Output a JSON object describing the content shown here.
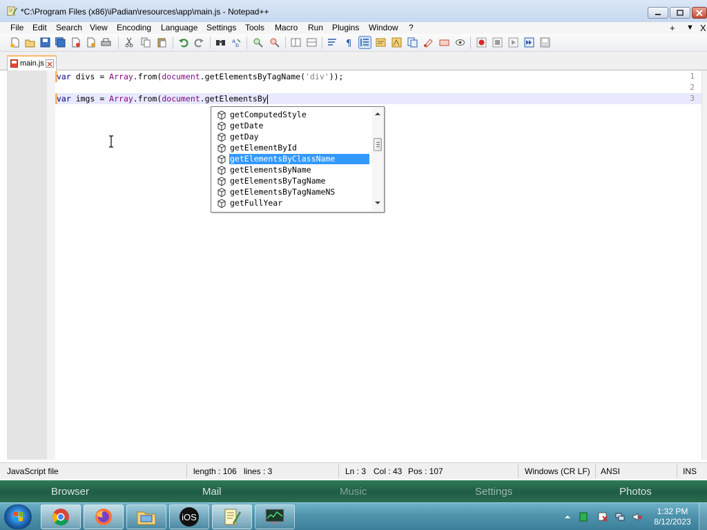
{
  "window": {
    "title": "*C:\\Program Files (x86)\\iPadian\\resources\\app\\main.js - Notepad++",
    "app_icon": "notepad-plus-plus-icon",
    "controls": [
      "minimize-icon",
      "maximize-icon",
      "close-icon"
    ]
  },
  "menu": {
    "items": [
      "File",
      "Edit",
      "Search",
      "View",
      "Encoding",
      "Language",
      "Settings",
      "Tools",
      "Macro",
      "Run",
      "Plugins",
      "Window",
      "?"
    ],
    "right": [
      "+",
      "▼",
      "X"
    ]
  },
  "toolbar": {
    "icons": [
      "new-file-icon",
      "open-file-icon",
      "save-icon",
      "save-all-icon",
      "close-icon",
      "close-all-icon",
      "print-icon",
      "cut-icon",
      "copy-icon",
      "paste-icon",
      "undo-icon",
      "redo-icon",
      "find-icon",
      "replace-icon",
      "zoom-in-icon",
      "zoom-out-icon",
      "sync-vertical-icon",
      "sync-horizontal-icon",
      "word-wrap-icon",
      "show-all-characters-icon",
      "indent-guide-icon",
      "language-icon",
      "document-map-icon",
      "function-list-icon",
      "folder-workspace-icon",
      "monitoring-icon",
      "record-macro-icon",
      "stop-macro-icon",
      "play-macro-icon",
      "run-macro-multiple-icon",
      "save-macro-icon"
    ]
  },
  "tab": {
    "label": "main.js",
    "icon": "modified-file-icon"
  },
  "editor": {
    "line_numbers": [
      "1",
      "2",
      "3"
    ],
    "lines": [
      {
        "kw": "var",
        "ident": " divs = ",
        "obj": "Array",
        "mid": ".from(",
        "obj2": "document",
        "rest": ".getElementsByTagName(",
        "str": "'div'",
        "end": "));"
      },
      {},
      {
        "kw": "var",
        "ident": " imgs = ",
        "obj": "Array",
        "mid": ".from(",
        "obj2": "document",
        "rest": ".getElementsBy"
      }
    ]
  },
  "autocomplete": {
    "items": [
      "getComputedStyle",
      "getDate",
      "getDay",
      "getElementById",
      "getElementsByClassName",
      "getElementsByName",
      "getElementsByTagName",
      "getElementsByTagNameNS",
      "getFullYear"
    ],
    "selected": "getElementsByClassName",
    "item_icon": "method-cube-icon"
  },
  "status": {
    "file_type": "JavaScript file",
    "length": "length : 106",
    "lines": "lines : 3",
    "ln": "Ln : 3",
    "col": "Col : 43",
    "pos": "Pos : 107",
    "eol": "Windows (CR LF)",
    "encoding": "ANSI",
    "mode": "INS"
  },
  "dock": {
    "items": [
      "Browser",
      "Mail",
      "Music",
      "Settings",
      "Photos"
    ]
  },
  "taskbar": {
    "apps": [
      "chrome-icon",
      "firefox-icon",
      "file-explorer-icon",
      "ios-icon",
      "notepad-plus-plus-icon",
      "task-manager-icon"
    ],
    "ios_label": "iOS",
    "tray": [
      "show-hidden-icons-icon",
      "battery-icon",
      "action-center-icon",
      "network-icon",
      "volume-muted-icon"
    ],
    "time": "1:32 PM",
    "date": "8/12/2023"
  }
}
